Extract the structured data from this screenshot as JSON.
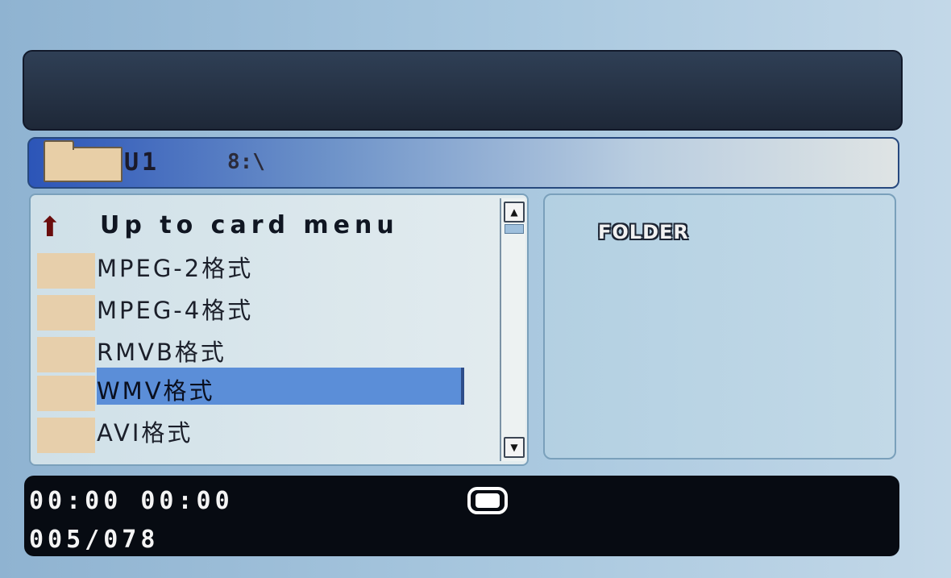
{
  "path": {
    "drive": "U1",
    "separator": "8:\\"
  },
  "file_list": {
    "items": [
      {
        "type": "up",
        "label": "Up to card menu",
        "icon": "up-arrow-icon"
      },
      {
        "type": "folder",
        "label": "MPEG-2格式",
        "icon": "folder-icon"
      },
      {
        "type": "folder",
        "label": "MPEG-4格式",
        "icon": "folder-icon"
      },
      {
        "type": "folder",
        "label": "RMVB格式",
        "icon": "folder-icon"
      },
      {
        "type": "folder",
        "label": "WMV格式",
        "icon": "folder-icon",
        "selected": true
      },
      {
        "type": "folder",
        "label": "AVI格式",
        "icon": "folder-icon"
      }
    ]
  },
  "info": {
    "label": "FOLDER"
  },
  "status": {
    "time": "00:00 00:00",
    "counter": "005/078",
    "mode_icon": "playback-mode-icon"
  },
  "colors": {
    "selection": "#5b8ed8",
    "status_bg": "#070b12",
    "title_bg": "#1e2838"
  }
}
